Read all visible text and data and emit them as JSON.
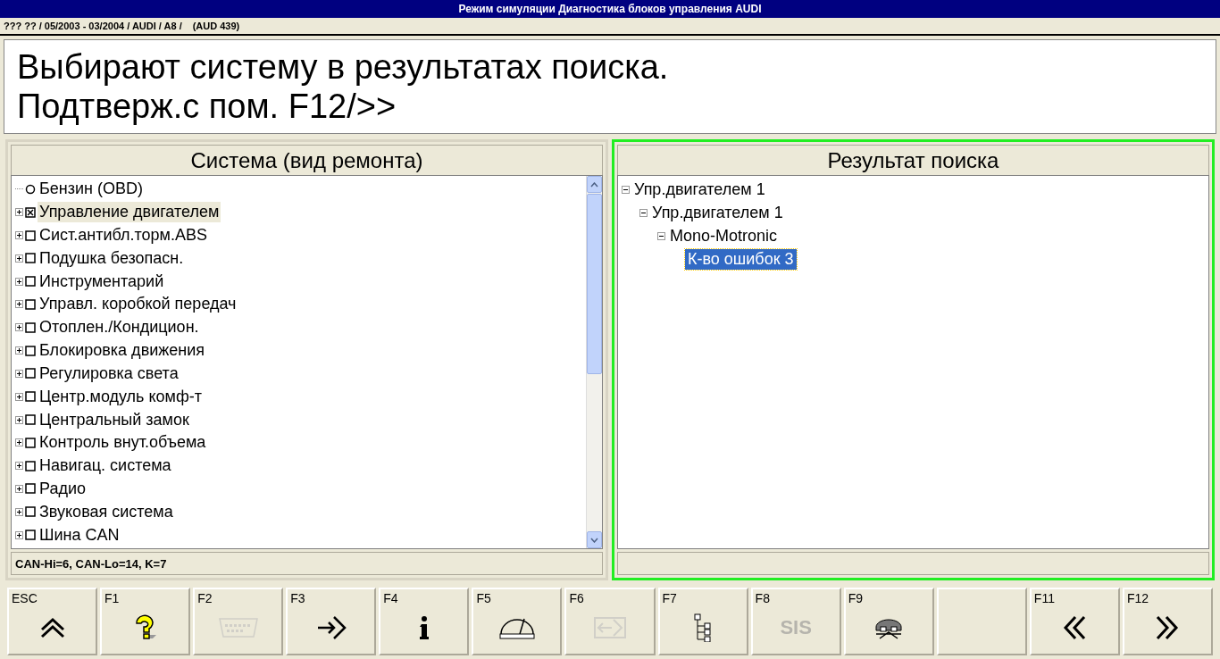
{
  "window": {
    "title": "Режим симуляции Диагностика блоков управления AUDI"
  },
  "breadcrumb": [
    "??? ?? / 05/2003 - 03/2004 / AUDI / A8 /",
    "(AUD 439)"
  ],
  "instruction": [
    "Выбирают систему в результатах поиска.",
    "Подтверж.с пом. F12/>>"
  ],
  "system_panel": {
    "title": "Система (вид ремонта)",
    "status": "CAN-Hi=6, CAN-Lo=14, K=7",
    "focused": false,
    "items": [
      {
        "label": "Бензин  (OBD)",
        "kind": "radio",
        "expandable": false,
        "checked": false,
        "selected": false
      },
      {
        "label": "Управление двигателем",
        "kind": "checkbox",
        "expandable": true,
        "checked": true,
        "selected": true
      },
      {
        "label": "Сист.антибл.торм.ABS",
        "kind": "checkbox",
        "expandable": true,
        "checked": false,
        "selected": false
      },
      {
        "label": "Подушка безопасн.",
        "kind": "checkbox",
        "expandable": true,
        "checked": false,
        "selected": false
      },
      {
        "label": "Инструментарий",
        "kind": "checkbox",
        "expandable": true,
        "checked": false,
        "selected": false
      },
      {
        "label": "Управл. коробкой передач",
        "kind": "checkbox",
        "expandable": true,
        "checked": false,
        "selected": false
      },
      {
        "label": "Отоплен./Кондицион.",
        "kind": "checkbox",
        "expandable": true,
        "checked": false,
        "selected": false
      },
      {
        "label": "Блокировка движения",
        "kind": "checkbox",
        "expandable": true,
        "checked": false,
        "selected": false
      },
      {
        "label": "Регулировка света",
        "kind": "checkbox",
        "expandable": true,
        "checked": false,
        "selected": false
      },
      {
        "label": "Центр.модуль комф-т",
        "kind": "checkbox",
        "expandable": true,
        "checked": false,
        "selected": false
      },
      {
        "label": "Центральный замок",
        "kind": "checkbox",
        "expandable": true,
        "checked": false,
        "selected": false
      },
      {
        "label": "Контроль внут.объема",
        "kind": "checkbox",
        "expandable": true,
        "checked": false,
        "selected": false
      },
      {
        "label": "Навигац. система",
        "kind": "checkbox",
        "expandable": true,
        "checked": false,
        "selected": false
      },
      {
        "label": "Радио",
        "kind": "checkbox",
        "expandable": true,
        "checked": false,
        "selected": false
      },
      {
        "label": "Звуковая система",
        "kind": "checkbox",
        "expandable": true,
        "checked": false,
        "selected": false
      },
      {
        "label": "Шина CAN",
        "kind": "checkbox",
        "expandable": true,
        "checked": false,
        "selected": false
      }
    ]
  },
  "results_panel": {
    "title": "Результат поиска",
    "focused": true,
    "tree": [
      {
        "label": "Упр.двигателем 1",
        "expanded": true,
        "selected": false,
        "children": [
          {
            "label": "Упр.двигателем 1",
            "expanded": true,
            "selected": false,
            "children": [
              {
                "label": "Mono-Motronic",
                "expanded": true,
                "selected": false,
                "children": [
                  {
                    "label": "К-во ошибок 3",
                    "selected": true
                  }
                ]
              }
            ]
          }
        ]
      }
    ]
  },
  "function_keys": [
    {
      "key": "ESC",
      "kind": "up",
      "disabled": false
    },
    {
      "key": "F1",
      "kind": "help",
      "disabled": false
    },
    {
      "key": "F2",
      "kind": "connector",
      "disabled": true
    },
    {
      "key": "F3",
      "kind": "enter",
      "disabled": false
    },
    {
      "key": "F4",
      "kind": "info",
      "disabled": false
    },
    {
      "key": "F5",
      "kind": "gauge",
      "disabled": false
    },
    {
      "key": "F6",
      "kind": "exit",
      "disabled": true
    },
    {
      "key": "F7",
      "kind": "tree",
      "disabled": false
    },
    {
      "key": "F8",
      "kind": "text",
      "text": "SIS",
      "disabled": true
    },
    {
      "key": "F9",
      "kind": "car",
      "disabled": false
    },
    {
      "kind": "blank"
    },
    {
      "key": "F11",
      "kind": "back",
      "disabled": false
    },
    {
      "key": "F12",
      "kind": "forward",
      "disabled": false
    }
  ]
}
